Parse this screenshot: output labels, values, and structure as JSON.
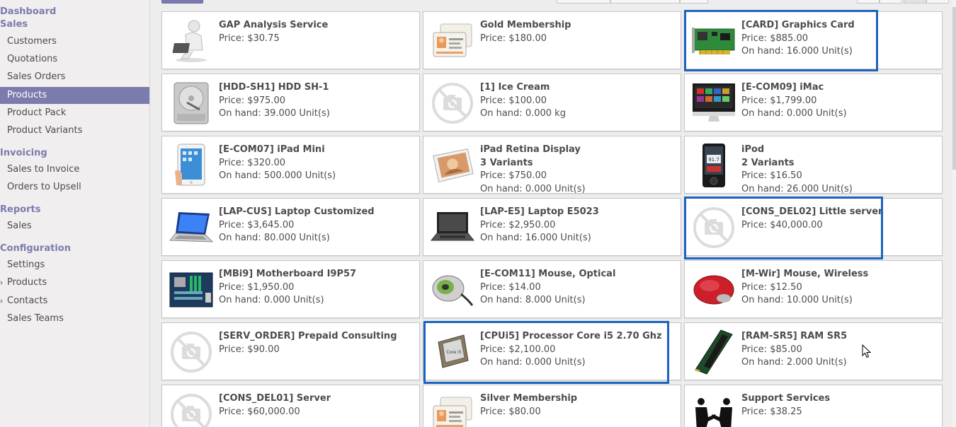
{
  "sidebar": {
    "sections": [
      {
        "title": "Dashboard"
      },
      {
        "title": "Sales",
        "items": [
          "Customers",
          "Quotations",
          "Sales Orders",
          "Products",
          "Product Pack",
          "Product Variants"
        ]
      },
      {
        "title": "Invoicing",
        "items": [
          "Sales to Invoice",
          "Orders to Upsell"
        ]
      },
      {
        "title": "Reports",
        "items": [
          "Sales"
        ]
      },
      {
        "title": "Configuration",
        "items": [
          "Settings",
          "Products",
          "Contacts",
          "Sales Teams"
        ]
      }
    ],
    "active_item": "Products"
  },
  "products": [
    {
      "name": "GAP Analysis Service",
      "price": "Price: $30.75",
      "icon": "person-laptop-icon"
    },
    {
      "name": "Gold Membership",
      "price": "Price: $180.00",
      "icon": "membership-cards-icon"
    },
    {
      "name": "[CARD] Graphics Card",
      "price": "Price: $885.00",
      "onhand": "On hand: 16.000 Unit(s)",
      "icon": "graphics-card-icon"
    },
    {
      "name": "[HDD-SH1] HDD SH-1",
      "price": "Price: $975.00",
      "onhand": "On hand: 39.000 Unit(s)",
      "icon": "hard-drive-icon"
    },
    {
      "name": "[1] Ice Cream",
      "price": "Price: $100.00",
      "onhand": "On hand: 0.000 kg",
      "icon": "no-image-icon"
    },
    {
      "name": "[E-COM09] iMac",
      "price": "Price: $1,799.00",
      "onhand": "On hand: 0.000 Unit(s)",
      "icon": "imac-icon"
    },
    {
      "name": "[E-COM07] iPad Mini",
      "price": "Price: $320.00",
      "onhand": "On hand: 500.000 Unit(s)",
      "icon": "ipad-mini-icon"
    },
    {
      "name": "iPad Retina Display",
      "variants": "3 Variants",
      "price": "Price: $750.00",
      "onhand": "On hand: 0.000 Unit(s)",
      "icon": "ipad-retina-icon"
    },
    {
      "name": "iPod",
      "variants": "2 Variants",
      "price": "Price: $16.50",
      "onhand": "On hand: 26.000 Unit(s)",
      "icon": "ipod-icon"
    },
    {
      "name": "[LAP-CUS] Laptop Customized",
      "price": "Price: $3,645.00",
      "onhand": "On hand: 80.000 Unit(s)",
      "icon": "laptop-icon"
    },
    {
      "name": "[LAP-E5] Laptop E5023",
      "price": "Price: $2,950.00",
      "onhand": "On hand: 16.000 Unit(s)",
      "icon": "laptop-dark-icon"
    },
    {
      "name": "[CONS_DEL02] Little server",
      "price": "Price: $40,000.00",
      "icon": "no-image-icon"
    },
    {
      "name": "[MBi9] Motherboard I9P57",
      "price": "Price: $1,950.00",
      "onhand": "On hand: 0.000 Unit(s)",
      "icon": "motherboard-icon"
    },
    {
      "name": "[E-COM11] Mouse, Optical",
      "price": "Price: $14.00",
      "onhand": "On hand: 8.000 Unit(s)",
      "icon": "optical-mouse-icon"
    },
    {
      "name": "[M-Wir] Mouse, Wireless",
      "price": "Price: $12.50",
      "onhand": "On hand: 10.000 Unit(s)",
      "icon": "wireless-mouse-icon"
    },
    {
      "name": "[SERV_ORDER] Prepaid Consulting",
      "price": "Price: $90.00",
      "icon": "no-image-icon"
    },
    {
      "name": "[CPUi5] Processor Core i5 2.70 Ghz",
      "price": "Price: $2,100.00",
      "onhand": "On hand: 0.000 Unit(s)",
      "icon": "processor-icon"
    },
    {
      "name": "[RAM-SR5] RAM SR5",
      "price": "Price: $85.00",
      "onhand": "On hand: 2.000 Unit(s)",
      "icon": "ram-icon"
    },
    {
      "name": "[CONS_DEL01] Server",
      "price": "Price: $60,000.00",
      "icon": "no-image-icon"
    },
    {
      "name": "Silver Membership",
      "price": "Price: $80.00",
      "icon": "membership-cards-icon"
    },
    {
      "name": "Support Services",
      "price": "Price: $38.25",
      "icon": "handshake-icon"
    }
  ],
  "highlighted": [
    "[CARD] Graphics Card",
    "[CONS_DEL02] Little server",
    "[CPUi5] Processor Core i5 2.70 Ghz"
  ],
  "colors": {
    "accent": "#7c7bad",
    "highlight": "#1a64c0"
  }
}
